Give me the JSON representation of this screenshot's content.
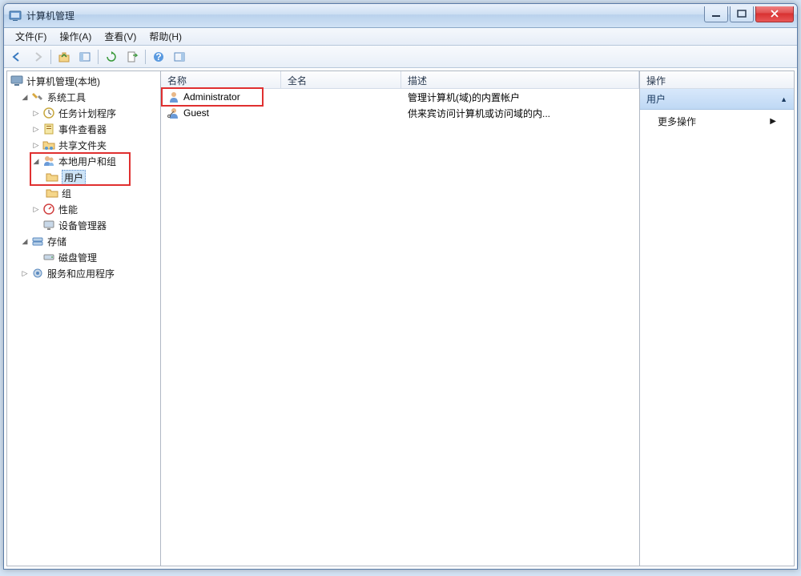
{
  "window": {
    "title": "计算机管理"
  },
  "menu": {
    "file": "文件(F)",
    "action": "操作(A)",
    "view": "查看(V)",
    "help": "帮助(H)"
  },
  "tree": {
    "root": "计算机管理(本地)",
    "system_tools": "系统工具",
    "task_scheduler": "任务计划程序",
    "event_viewer": "事件查看器",
    "shared_folders": "共享文件夹",
    "local_users_groups": "本地用户和组",
    "users": "用户",
    "groups": "组",
    "performance": "性能",
    "device_manager": "设备管理器",
    "storage": "存储",
    "disk_management": "磁盘管理",
    "services_apps": "服务和应用程序"
  },
  "list": {
    "headers": {
      "name": "名称",
      "fullname": "全名",
      "description": "描述"
    },
    "rows": [
      {
        "name": "Administrator",
        "fullname": "",
        "description": "管理计算机(域)的内置帐户"
      },
      {
        "name": "Guest",
        "fullname": "",
        "description": "供来宾访问计算机或访问域的内..."
      }
    ]
  },
  "actions": {
    "header": "操作",
    "title": "用户",
    "more": "更多操作"
  }
}
